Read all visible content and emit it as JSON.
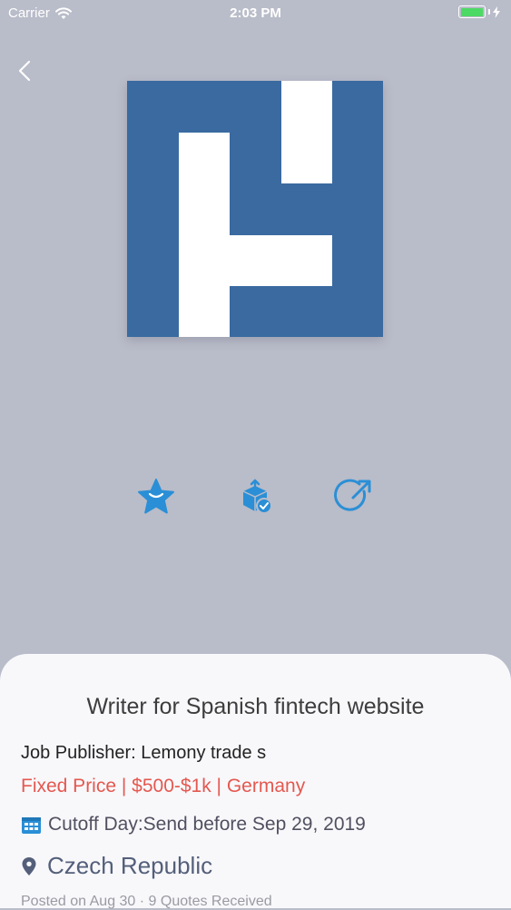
{
  "status_bar": {
    "carrier": "Carrier",
    "time": "2:03 PM",
    "battery_level": 1.0
  },
  "icons": {
    "back": "chevron-left-icon",
    "favorite": "star-icon",
    "apply": "box-check-icon",
    "share": "share-arrow-icon",
    "calendar": "calendar-icon",
    "location": "location-pin-icon"
  },
  "colors": {
    "accent": "#2a8fd6",
    "price": "#e4584f",
    "logo_blue": "#3a6aa0"
  },
  "job": {
    "title": "Writer for Spanish fintech website",
    "publisher": "Job Publisher: Lemony trade s",
    "price_info": "Fixed Price | $500-$1k | Germany",
    "cutoff": "Cutoff Day:Send before Sep 29, 2019",
    "location": "Czech Republic",
    "posted": "Posted on Aug 30 · 9 Quotes Received"
  }
}
